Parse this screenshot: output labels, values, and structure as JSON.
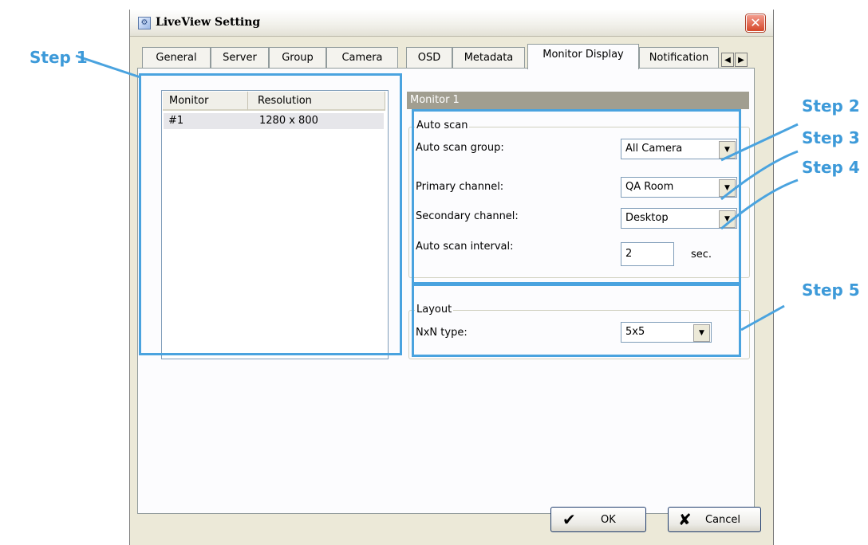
{
  "window": {
    "title": "LiveView Setting",
    "close_glyph": "✕",
    "app_icon": "settings-window-icon"
  },
  "tabs": [
    {
      "label": "General"
    },
    {
      "label": "Server"
    },
    {
      "label": "Group"
    },
    {
      "label": "Camera"
    },
    {
      "label": "OSD"
    },
    {
      "label": "Metadata"
    },
    {
      "label": "Monitor Display",
      "active": true
    },
    {
      "label": "Notification"
    }
  ],
  "tab_scroll": {
    "left": "◀",
    "right": "▶"
  },
  "monitor_list": {
    "columns": [
      "Monitor",
      "Resolution"
    ],
    "rows": [
      {
        "monitor": "#1",
        "resolution": "1280 x 800"
      }
    ]
  },
  "monitor_panel": {
    "header": "Monitor 1",
    "auto_scan": {
      "group_label": "Auto scan",
      "scan_group_label": "Auto scan group:",
      "scan_group_value": "All Camera",
      "primary_label": "Primary channel:",
      "primary_value": "QA Room",
      "secondary_label": "Secondary channel:",
      "secondary_value": "Desktop",
      "interval_label": "Auto scan interval:",
      "interval_value": "2",
      "interval_unit": "sec."
    },
    "layout": {
      "group_label": "Layout",
      "nxn_label": "NxN type:",
      "nxn_value": "5x5"
    }
  },
  "buttons": {
    "ok": "OK",
    "cancel": "Cancel",
    "ok_glyph": "✔",
    "cancel_glyph": "✘"
  },
  "dropdown_glyph": "▼",
  "annotations": {
    "step1": "Step 1",
    "step2": "Step 2",
    "step3": "Step 3",
    "step4": "Step 4",
    "step5": "Step 5"
  },
  "colors": {
    "annotation": "#3d9ad9",
    "title_close": "#d5472a",
    "header_bg": "#a19e90"
  }
}
